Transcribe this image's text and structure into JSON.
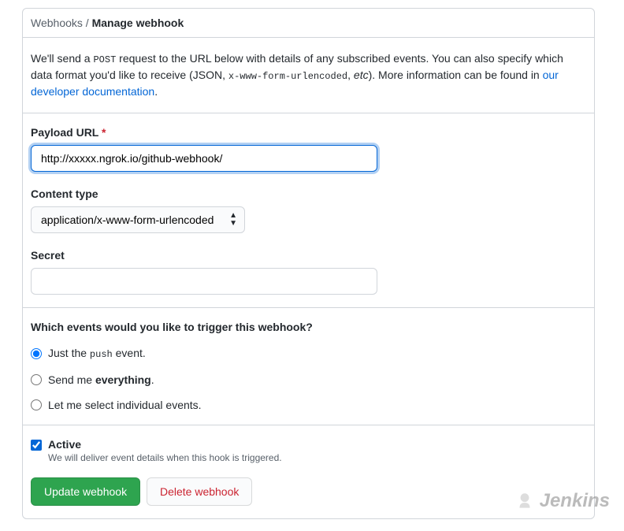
{
  "breadcrumb": {
    "parent": "Webhooks",
    "current": "Manage webhook"
  },
  "description": {
    "text1": "We'll send a ",
    "code1": "POST",
    "text2": " request to the URL below with details of any subscribed events. You can also specify which data format you'd like to receive (JSON, ",
    "code2": "x-www-form-urlencoded",
    "text3": ", ",
    "etc": "etc",
    "text4": "). More information can be found in ",
    "link": "our developer documentation",
    "period": "."
  },
  "form": {
    "payload_url": {
      "label": "Payload URL",
      "value": "http://xxxxx.ngrok.io/github-webhook/"
    },
    "content_type": {
      "label": "Content type",
      "value": "application/x-www-form-urlencoded"
    },
    "secret": {
      "label": "Secret",
      "value": ""
    }
  },
  "events": {
    "question": "Which events would you like to trigger this webhook?",
    "options": [
      {
        "pre": "Just the ",
        "code": "push",
        "post": " event."
      },
      {
        "pre": "Send me ",
        "bold": "everything",
        "post": "."
      },
      {
        "plain": "Let me select individual events."
      }
    ]
  },
  "active": {
    "title": "Active",
    "desc": "We will deliver event details when this hook is triggered."
  },
  "buttons": {
    "update": "Update webhook",
    "delete": "Delete webhook"
  },
  "watermark": {
    "text": "Jenkins"
  }
}
